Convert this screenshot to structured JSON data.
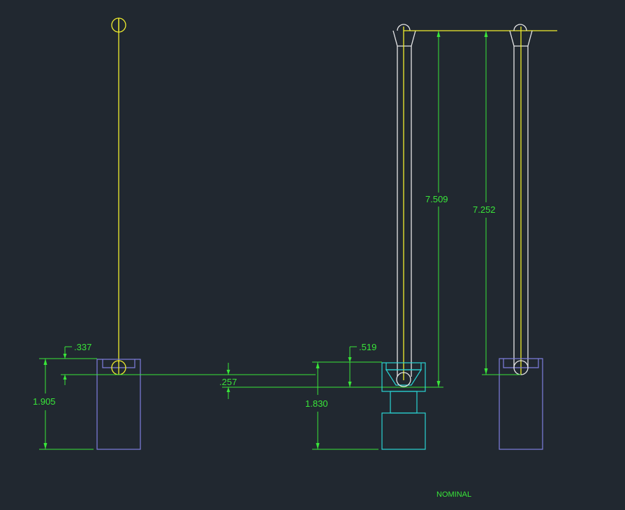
{
  "dimensions": {
    "left_top_offset": ".337",
    "left_height": "1.905",
    "center_offset": ".257",
    "mid_top_offset": ".519",
    "mid_height": "1.830",
    "mid_length": "7.509",
    "right_length": "7.252"
  },
  "note": "NOMINAL",
  "colors": {
    "background": "#212830",
    "dimension": "#39e639",
    "centerline": "#f2ef2e",
    "outline": "#e8e8e8",
    "block_blue": "#7f7fdf",
    "block_cyan": "#2ad4d4"
  }
}
